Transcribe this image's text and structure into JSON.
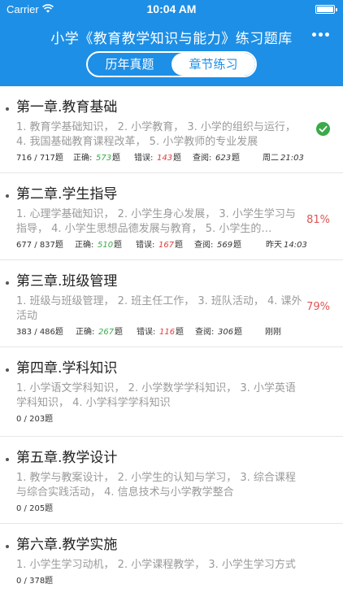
{
  "status_bar": {
    "carrier": "Carrier",
    "time": "10:04 AM"
  },
  "nav": {
    "title": "小学《教育教学知识与能力》练习题库"
  },
  "tabs": [
    {
      "label": "历年真题",
      "active": false
    },
    {
      "label": "章节练习",
      "active": true
    }
  ],
  "labels": {
    "correct": "正确:",
    "wrong": "错误:",
    "viewed": "查阅:",
    "unit": "题"
  },
  "chapters": [
    {
      "title": "第一章.教育基础",
      "desc": "1. 教育学基础知识， 2. 小学教育， 3. 小学的组织与运行， 4. 我国基础教育课程改革， 5. 小学教师的专业发展",
      "progress": "716 / 717题",
      "correct": "573",
      "wrong": "143",
      "viewed": "623",
      "day": "周二",
      "clock": "21:03",
      "status": "check"
    },
    {
      "title": "第二章.学生指导",
      "desc": "1. 心理学基础知识， 2. 小学生身心发展， 3. 小学生学习与指导， 4. 小学生思想品德发展与教育， 5. 小学生的…",
      "progress": "677 / 837题",
      "correct": "510",
      "wrong": "167",
      "viewed": "569",
      "day": "昨天",
      "clock": "14:03",
      "pct": "81%"
    },
    {
      "title": "第三章.班级管理",
      "desc": "1. 班级与班级管理， 2. 班主任工作， 3. 班队活动， 4. 课外活动",
      "progress": "383 / 486题",
      "correct": "267",
      "wrong": "116",
      "viewed": "306",
      "day": "刚刚",
      "clock": "",
      "pct": "79%"
    },
    {
      "title": "第四章.学科知识",
      "desc": "1. 小学语文学科知识， 2. 小学数学学科知识， 3. 小学英语学科知识， 4. 小学科学学科知识",
      "progress": "0 / 203题"
    },
    {
      "title": "第五章.教学设计",
      "desc": "1. 教学与教案设计， 2. 小学生的认知与学习， 3. 综合课程与综合实践活动， 4. 信息技术与小学教学整合",
      "progress": "0 / 205题"
    },
    {
      "title": "第六章.教学实施",
      "desc": "1. 小学生学习动机， 2. 小学课程教学， 3. 小学生学习方式",
      "progress": "0 / 378题"
    }
  ],
  "colors": {
    "header": "#1e8fe6",
    "correct": "#3aaa4a",
    "wrong": "#e03b3b",
    "percent": "#e05555"
  }
}
